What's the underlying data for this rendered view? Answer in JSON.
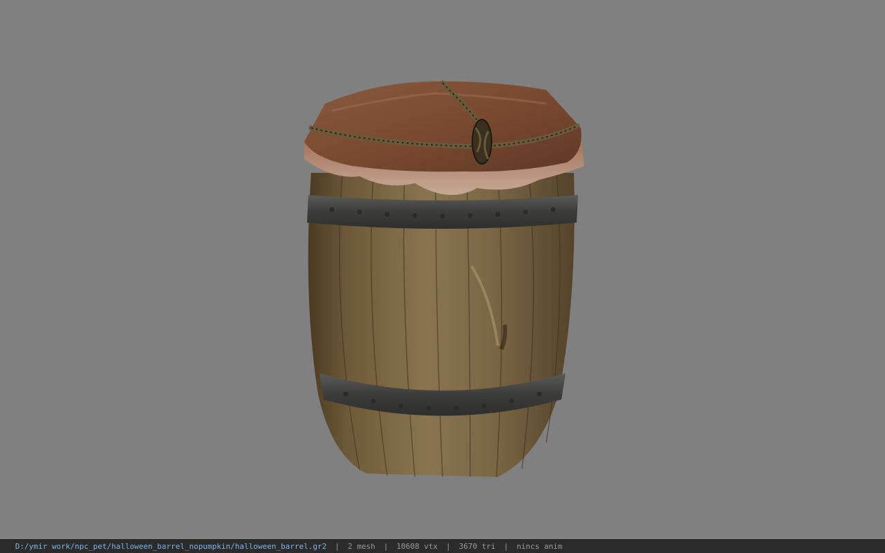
{
  "viewer": {
    "background_color": "#808080",
    "model_icon": "barrel-model",
    "status": {
      "file_path": "D:/ymir work/npc_pet/halloween_barrel_nopumpkin/halloween_barrel.gr2",
      "separator": "|",
      "mesh_count": "2 mesh",
      "vertex_count": "10608 vtx",
      "triangle_count": "3670 tri",
      "anim_status": "nincs anim"
    }
  }
}
